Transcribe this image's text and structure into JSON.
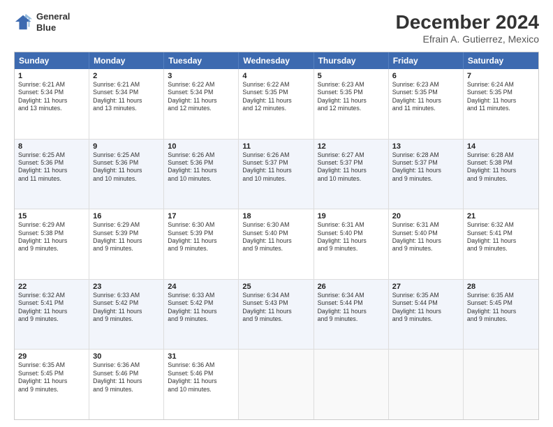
{
  "header": {
    "logo_line1": "General",
    "logo_line2": "Blue",
    "month": "December 2024",
    "location": "Efrain A. Gutierrez, Mexico"
  },
  "weekdays": [
    "Sunday",
    "Monday",
    "Tuesday",
    "Wednesday",
    "Thursday",
    "Friday",
    "Saturday"
  ],
  "rows": [
    [
      {
        "day": "1",
        "text": "Sunrise: 6:21 AM\nSunset: 5:34 PM\nDaylight: 11 hours\nand 13 minutes."
      },
      {
        "day": "2",
        "text": "Sunrise: 6:21 AM\nSunset: 5:34 PM\nDaylight: 11 hours\nand 13 minutes."
      },
      {
        "day": "3",
        "text": "Sunrise: 6:22 AM\nSunset: 5:34 PM\nDaylight: 11 hours\nand 12 minutes."
      },
      {
        "day": "4",
        "text": "Sunrise: 6:22 AM\nSunset: 5:35 PM\nDaylight: 11 hours\nand 12 minutes."
      },
      {
        "day": "5",
        "text": "Sunrise: 6:23 AM\nSunset: 5:35 PM\nDaylight: 11 hours\nand 12 minutes."
      },
      {
        "day": "6",
        "text": "Sunrise: 6:23 AM\nSunset: 5:35 PM\nDaylight: 11 hours\nand 11 minutes."
      },
      {
        "day": "7",
        "text": "Sunrise: 6:24 AM\nSunset: 5:35 PM\nDaylight: 11 hours\nand 11 minutes."
      }
    ],
    [
      {
        "day": "8",
        "text": "Sunrise: 6:25 AM\nSunset: 5:36 PM\nDaylight: 11 hours\nand 11 minutes."
      },
      {
        "day": "9",
        "text": "Sunrise: 6:25 AM\nSunset: 5:36 PM\nDaylight: 11 hours\nand 10 minutes."
      },
      {
        "day": "10",
        "text": "Sunrise: 6:26 AM\nSunset: 5:36 PM\nDaylight: 11 hours\nand 10 minutes."
      },
      {
        "day": "11",
        "text": "Sunrise: 6:26 AM\nSunset: 5:37 PM\nDaylight: 11 hours\nand 10 minutes."
      },
      {
        "day": "12",
        "text": "Sunrise: 6:27 AM\nSunset: 5:37 PM\nDaylight: 11 hours\nand 10 minutes."
      },
      {
        "day": "13",
        "text": "Sunrise: 6:28 AM\nSunset: 5:37 PM\nDaylight: 11 hours\nand 9 minutes."
      },
      {
        "day": "14",
        "text": "Sunrise: 6:28 AM\nSunset: 5:38 PM\nDaylight: 11 hours\nand 9 minutes."
      }
    ],
    [
      {
        "day": "15",
        "text": "Sunrise: 6:29 AM\nSunset: 5:38 PM\nDaylight: 11 hours\nand 9 minutes."
      },
      {
        "day": "16",
        "text": "Sunrise: 6:29 AM\nSunset: 5:39 PM\nDaylight: 11 hours\nand 9 minutes."
      },
      {
        "day": "17",
        "text": "Sunrise: 6:30 AM\nSunset: 5:39 PM\nDaylight: 11 hours\nand 9 minutes."
      },
      {
        "day": "18",
        "text": "Sunrise: 6:30 AM\nSunset: 5:40 PM\nDaylight: 11 hours\nand 9 minutes."
      },
      {
        "day": "19",
        "text": "Sunrise: 6:31 AM\nSunset: 5:40 PM\nDaylight: 11 hours\nand 9 minutes."
      },
      {
        "day": "20",
        "text": "Sunrise: 6:31 AM\nSunset: 5:40 PM\nDaylight: 11 hours\nand 9 minutes."
      },
      {
        "day": "21",
        "text": "Sunrise: 6:32 AM\nSunset: 5:41 PM\nDaylight: 11 hours\nand 9 minutes."
      }
    ],
    [
      {
        "day": "22",
        "text": "Sunrise: 6:32 AM\nSunset: 5:41 PM\nDaylight: 11 hours\nand 9 minutes."
      },
      {
        "day": "23",
        "text": "Sunrise: 6:33 AM\nSunset: 5:42 PM\nDaylight: 11 hours\nand 9 minutes."
      },
      {
        "day": "24",
        "text": "Sunrise: 6:33 AM\nSunset: 5:42 PM\nDaylight: 11 hours\nand 9 minutes."
      },
      {
        "day": "25",
        "text": "Sunrise: 6:34 AM\nSunset: 5:43 PM\nDaylight: 11 hours\nand 9 minutes."
      },
      {
        "day": "26",
        "text": "Sunrise: 6:34 AM\nSunset: 5:44 PM\nDaylight: 11 hours\nand 9 minutes."
      },
      {
        "day": "27",
        "text": "Sunrise: 6:35 AM\nSunset: 5:44 PM\nDaylight: 11 hours\nand 9 minutes."
      },
      {
        "day": "28",
        "text": "Sunrise: 6:35 AM\nSunset: 5:45 PM\nDaylight: 11 hours\nand 9 minutes."
      }
    ],
    [
      {
        "day": "29",
        "text": "Sunrise: 6:35 AM\nSunset: 5:45 PM\nDaylight: 11 hours\nand 9 minutes."
      },
      {
        "day": "30",
        "text": "Sunrise: 6:36 AM\nSunset: 5:46 PM\nDaylight: 11 hours\nand 9 minutes."
      },
      {
        "day": "31",
        "text": "Sunrise: 6:36 AM\nSunset: 5:46 PM\nDaylight: 11 hours\nand 10 minutes."
      },
      {
        "day": "",
        "text": ""
      },
      {
        "day": "",
        "text": ""
      },
      {
        "day": "",
        "text": ""
      },
      {
        "day": "",
        "text": ""
      }
    ]
  ]
}
